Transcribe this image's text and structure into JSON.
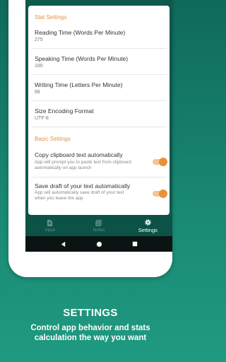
{
  "stat_settings": {
    "title": "Stat Settings",
    "items": [
      {
        "label": "Reading Time (Words Per Minute)",
        "value": "275"
      },
      {
        "label": "Speaking Time (Words Per Minute)",
        "value": "180"
      },
      {
        "label": "Writing Time (Letters Per Minute)",
        "value": "68"
      },
      {
        "label": "Size Encoding Format",
        "value": "UTF-8"
      }
    ]
  },
  "basic_settings": {
    "title": "Basic Settings",
    "items": [
      {
        "label": "Copy clipboard text automatically",
        "desc": "App will prompt you to paste text from clipboard automatically on app launch",
        "enabled": true
      },
      {
        "label": "Save draft of your text automatically",
        "desc": "App will automatically save draft of your text when you leave the app",
        "enabled": true
      }
    ]
  },
  "bottom_nav": {
    "items": [
      {
        "label": "Input",
        "icon": "input-icon",
        "active": false
      },
      {
        "label": "Notes",
        "icon": "notes-icon",
        "active": false
      },
      {
        "label": "Settings",
        "icon": "gear-icon",
        "active": true
      }
    ]
  },
  "caption": {
    "title": "SETTINGS",
    "subtitle": "Control app behavior and stats calculation the way you want"
  },
  "colors": {
    "accent": "#e8913b",
    "primary_dark": "#0c5246",
    "background": "#1a8a74"
  }
}
